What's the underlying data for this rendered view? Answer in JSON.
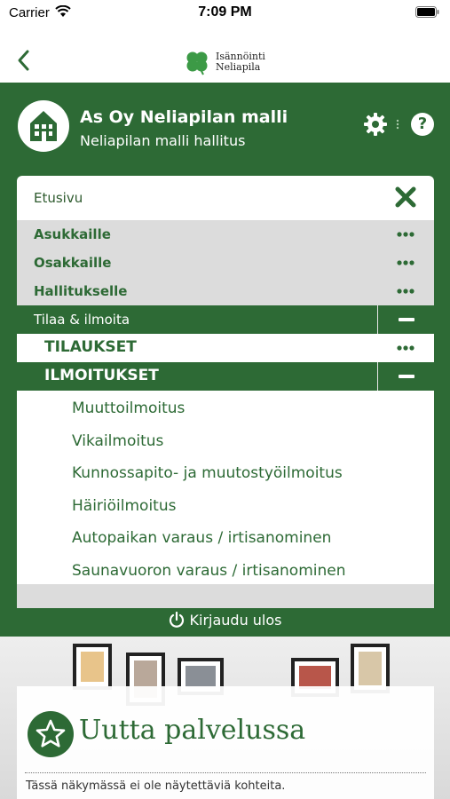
{
  "status_bar": {
    "carrier": "Carrier",
    "time": "7:09 PM"
  },
  "brand": {
    "line1": "Isännöinti",
    "line2": "Neliapila"
  },
  "header": {
    "title": "As Oy Neliapilan malli",
    "subtitle": "Neliapilan malli hallitus"
  },
  "menu": {
    "home_label": "Etusivu",
    "sections": [
      {
        "label": "Asukkaille"
      },
      {
        "label": "Osakkaille"
      },
      {
        "label": "Hallitukselle"
      }
    ],
    "expanded": {
      "label": "Tilaa & ilmoita",
      "groups": [
        {
          "label": "TILAUKSET"
        },
        {
          "label": "ILMOITUKSET",
          "items": [
            "Muuttoilmoitus",
            "Vikailmoitus",
            "Kunnossapito- ja muutostyöilmoitus",
            "Häiriöilmoitus",
            "Autopaikan varaus / irtisanominen",
            "Saunavuoron varaus / irtisanominen"
          ]
        }
      ]
    }
  },
  "logout_label": "Kirjaudu ulos",
  "news": {
    "title": "Uutta palvelussa",
    "empty_text": "Tässä näkymässä ei ole näytettäviä kohteita."
  },
  "colors": {
    "brand_green": "#2d6a35",
    "menu_gray": "#dcdcdc"
  },
  "icons": [
    "back-icon",
    "clover-logo-icon",
    "house-icon",
    "gear-icon",
    "help-icon",
    "close-icon",
    "more-dots-icon",
    "collapse-icon",
    "power-icon",
    "star-icon"
  ]
}
